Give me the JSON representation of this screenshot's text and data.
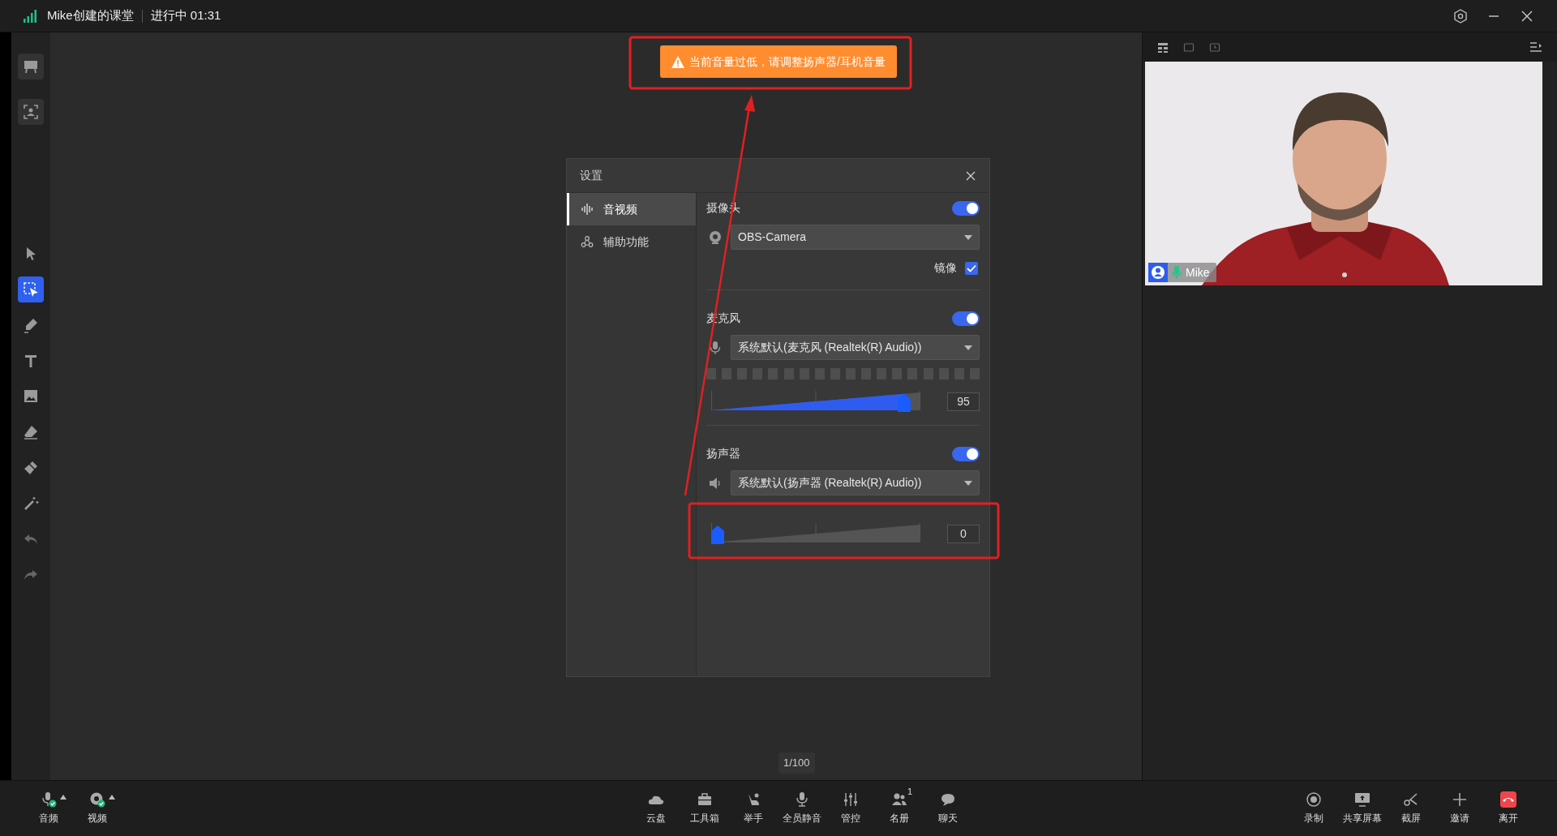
{
  "title_bar": {
    "room": "Mike创建的课堂",
    "status": "进行中 01:31"
  },
  "tools": [
    {
      "kind": "panel",
      "selected": false
    },
    {
      "kind": "panel",
      "selected": false
    },
    {
      "kind": "tool",
      "selected": false
    },
    {
      "kind": "tool",
      "selected": true
    },
    {
      "kind": "tool",
      "selected": false
    },
    {
      "kind": "tool",
      "selected": false
    },
    {
      "kind": "tool",
      "selected": false
    },
    {
      "kind": "tool",
      "selected": false
    },
    {
      "kind": "tool",
      "selected": false
    },
    {
      "kind": "tool",
      "selected": false
    },
    {
      "kind": "tool",
      "selected": false
    },
    {
      "kind": "tool",
      "selected": false
    }
  ],
  "toast": {
    "text": "当前音量过低，请调整扬声器/耳机音量"
  },
  "dialog": {
    "title": "设置",
    "nav": [
      {
        "label": "音视频",
        "selected": true
      },
      {
        "label": "辅助功能",
        "selected": false
      }
    ],
    "sections": [
      {
        "kind": "camera",
        "title": "摄像头",
        "on": true,
        "device": "OBS-Camera",
        "mirror": {
          "label": "镜像",
          "checked": true
        }
      },
      {
        "kind": "microphone",
        "title": "麦克风",
        "on": true,
        "device": "系统默认(麦克风 (Realtek(R) Audio))",
        "level": 0.95,
        "reading": "95"
      },
      {
        "kind": "speaker",
        "title": "扬声器",
        "on": true,
        "device": "系统默认(扬声器 (Realtek(R) Audio))",
        "level": 0,
        "reading": "0"
      }
    ]
  },
  "page_indicator": "1/100",
  "video": {
    "name": "Mike"
  },
  "bottom_bar": {
    "left": [
      {
        "label": "音频"
      },
      {
        "label": "视频"
      }
    ],
    "center": [
      {
        "label": "云盘"
      },
      {
        "label": "工具箱"
      },
      {
        "label": "举手"
      },
      {
        "label": "全员静音"
      },
      {
        "label": "管控"
      },
      {
        "label": "名册",
        "badge": "1"
      },
      {
        "label": "聊天"
      }
    ],
    "right": [
      {
        "label": "录制"
      },
      {
        "label": "共享屏幕"
      },
      {
        "label": "截屏"
      },
      {
        "label": "邀请"
      },
      {
        "label": "离开"
      }
    ]
  }
}
